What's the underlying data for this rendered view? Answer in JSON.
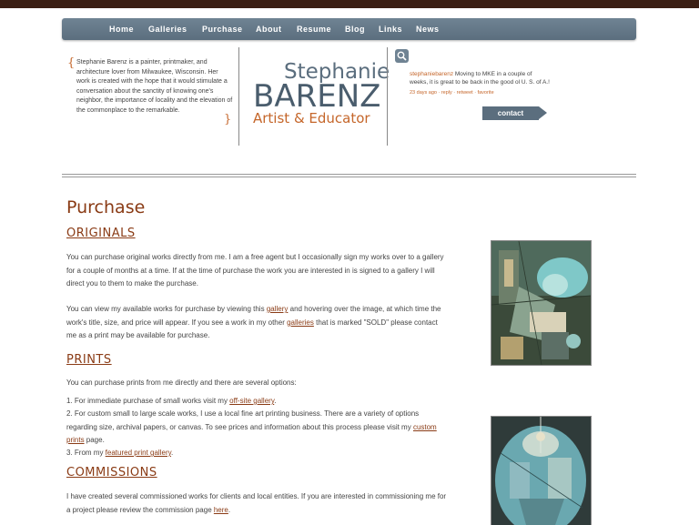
{
  "nav": {
    "items": [
      {
        "label": "Home"
      },
      {
        "label": "Galleries"
      },
      {
        "label": "Purchase"
      },
      {
        "label": "About"
      },
      {
        "label": "Resume"
      },
      {
        "label": "Blog"
      },
      {
        "label": "Links"
      },
      {
        "label": "News"
      }
    ]
  },
  "header": {
    "bio": "Stephanie Barenz is a painter, printmaker, and architecture lover from Milwaukee, Wisconsin. Her work is created with the hope that it would stimulate a conversation about the sanctity of knowing one's neighbor, the importance of locality and the elevation of the commonplace to the remarkable.",
    "brace_open": "{",
    "brace_close": "}",
    "logo_first": "Stephanie",
    "logo_last": "BARENZ",
    "logo_sub": "Artist & Educator",
    "tweet_user": "stephaniebarenz",
    "tweet_text": " Moving to MKE in a couple of weeks, it is great to be back in the good ol U. S. of A.!",
    "tweet_meta": "23 days ago · reply · retweet · favorite",
    "contact_label": "contact"
  },
  "main": {
    "title": "Purchase",
    "originals": {
      "heading": "ORIGINALS",
      "p1": "You can purchase original works directly from me. I am a free agent but I occasionally sign my works over to a gallery for a couple of months at a time. If at the time of purchase the work you are interested in is signed to a gallery I will direct you to them to make the purchase.",
      "p2_a": "You can view my available works for purchase by viewing this ",
      "p2_link1": "gallery",
      "p2_b": " and hovering over the image, at which time the work's title, size, and price will appear. If you see a work in my other ",
      "p2_link2": "galleries",
      "p2_c": " that is marked \"SOLD\" please contact me as a print may be available for purchase."
    },
    "prints": {
      "heading": "PRINTS",
      "intro": "You can purchase prints from me directly and there are several options:",
      "item1_a": "1. For immediate purchase of small works visit my ",
      "item1_link": "off-site gallery",
      "item1_b": ".",
      "item2_a": "2. For custom small to large scale works, I use a local fine art printing business. There are a variety of options regarding size, archival papers, or canvas. To see prices and information about this process please visit my ",
      "item2_link": "custom prints",
      "item2_b": " page.",
      "item3_a": "3. From my ",
      "item3_link": "featured print gallery",
      "item3_b": "."
    },
    "commissions": {
      "heading": "COMMISSIONS",
      "p_a": "I have created several commissioned works for clients and local entities. If you are interested in commissioning me for a project please review the commission page ",
      "p_link": "here",
      "p_b": "."
    }
  },
  "colors": {
    "accent": "#8a3b15",
    "nav": "#5b6e7e",
    "orange": "#c5662a"
  }
}
